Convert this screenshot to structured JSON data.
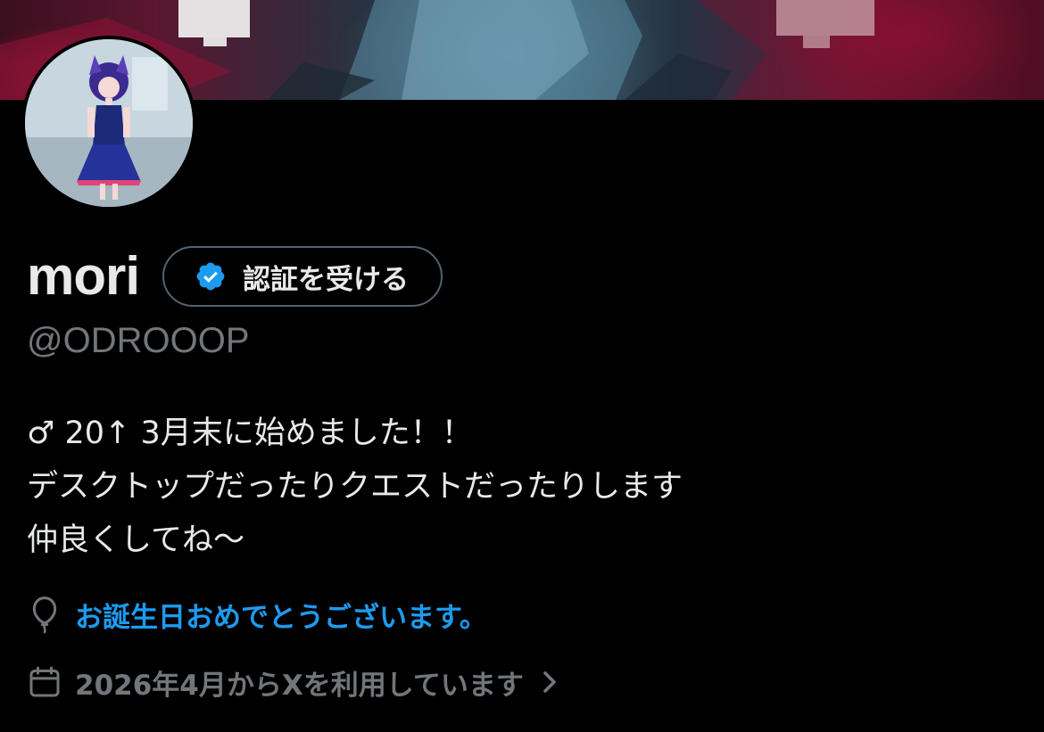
{
  "profile": {
    "display_name": "mori",
    "handle": "@ODROOOP",
    "verify_button_label": "認証を受ける",
    "bio_lines": [
      "♂ 20↑ 3月末に始めました！！",
      "デスクトップだったりクエストだったりします",
      "仲良くしてね〜"
    ],
    "birthday_text": "お誕生日おめでとうございます。",
    "joined_text": "2026年4月からXを利用しています"
  },
  "icons": {
    "verify_badge": "verified-badge-icon",
    "birthday": "balloon-icon",
    "joined": "calendar-icon",
    "joined_chevron": "chevron-right-icon"
  },
  "colors": {
    "background": "#000000",
    "primary_text": "#e7e9ea",
    "secondary_text": "#71767b",
    "accent": "#1d9bf0",
    "button_border": "#536471"
  }
}
